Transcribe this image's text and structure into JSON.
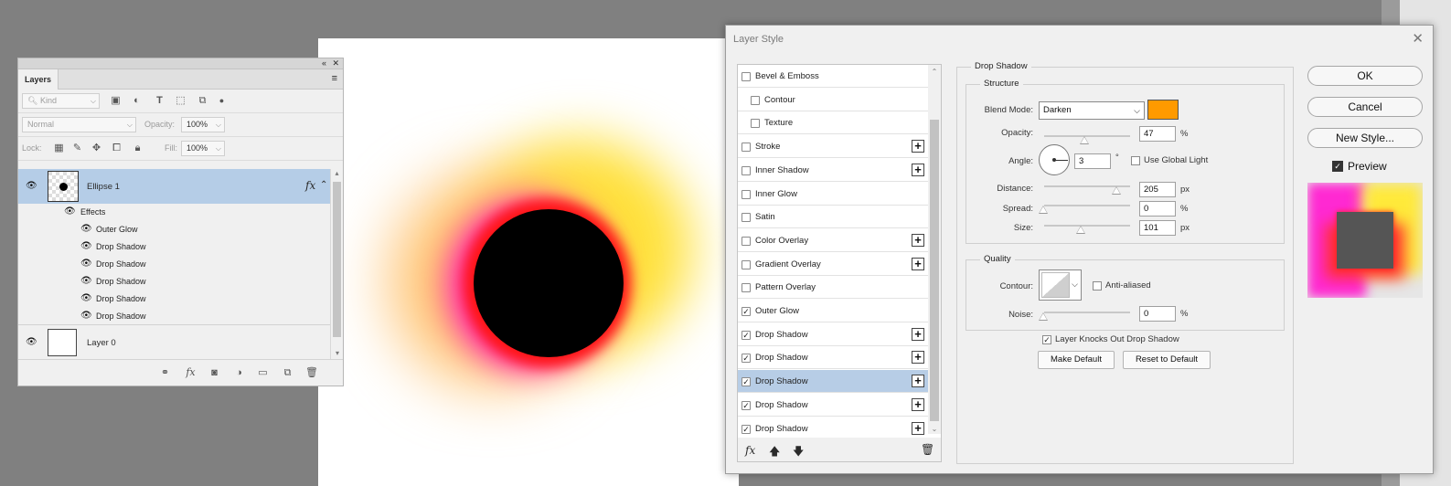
{
  "colors": {
    "shadow_color": "#ff9a00",
    "selected_row": "#b7cde6",
    "layer_selected": "#b5cde7"
  },
  "layers_panel": {
    "tab_label": "Layers",
    "filter_kind": "Kind",
    "blend_mode": "Normal",
    "opacity_label": "Opacity:",
    "opacity_value": "100%",
    "lock_label": "Lock:",
    "fill_label": "Fill:",
    "fill_value": "100%",
    "layers": [
      {
        "name": "Ellipse 1",
        "fx": "fx"
      },
      {
        "name": "Layer 0"
      }
    ],
    "effects_label": "Effects",
    "effects": [
      "Outer Glow",
      "Drop Shadow",
      "Drop Shadow",
      "Drop Shadow",
      "Drop Shadow",
      "Drop Shadow"
    ]
  },
  "dialog": {
    "title": "Layer Style",
    "styles": [
      {
        "label": "Bevel & Emboss",
        "checked": false,
        "plus": false,
        "indent": false
      },
      {
        "label": "Contour",
        "checked": false,
        "plus": false,
        "indent": true
      },
      {
        "label": "Texture",
        "checked": false,
        "plus": false,
        "indent": true
      },
      {
        "label": "Stroke",
        "checked": false,
        "plus": true,
        "indent": false
      },
      {
        "label": "Inner Shadow",
        "checked": false,
        "plus": true,
        "indent": false
      },
      {
        "label": "Inner Glow",
        "checked": false,
        "plus": false,
        "indent": false
      },
      {
        "label": "Satin",
        "checked": false,
        "plus": false,
        "indent": false
      },
      {
        "label": "Color Overlay",
        "checked": false,
        "plus": true,
        "indent": false
      },
      {
        "label": "Gradient Overlay",
        "checked": false,
        "plus": true,
        "indent": false
      },
      {
        "label": "Pattern Overlay",
        "checked": false,
        "plus": false,
        "indent": false
      },
      {
        "label": "Outer Glow",
        "checked": true,
        "plus": false,
        "indent": false
      },
      {
        "label": "Drop Shadow",
        "checked": true,
        "plus": true,
        "indent": false
      },
      {
        "label": "Drop Shadow",
        "checked": true,
        "plus": true,
        "indent": false
      },
      {
        "label": "Drop Shadow",
        "checked": true,
        "plus": true,
        "indent": false,
        "active": true
      },
      {
        "label": "Drop Shadow",
        "checked": true,
        "plus": true,
        "indent": false
      },
      {
        "label": "Drop Shadow",
        "checked": true,
        "plus": true,
        "indent": false
      }
    ],
    "section_title": "Drop Shadow",
    "structure_title": "Structure",
    "blend_mode_label": "Blend Mode:",
    "blend_mode": "Darken",
    "opacity_label": "Opacity:",
    "opacity": "47",
    "angle_label": "Angle:",
    "angle": "3",
    "global_light_label": "Use Global Light",
    "distance_label": "Distance:",
    "distance": "205",
    "spread_label": "Spread:",
    "spread": "0",
    "size_label": "Size:",
    "size": "101",
    "pct": "%",
    "px": "px",
    "deg": "°",
    "quality_title": "Quality",
    "contour_label": "Contour:",
    "antialiased_label": "Anti-aliased",
    "noise_label": "Noise:",
    "noise": "0",
    "knockout_label": "Layer Knocks Out Drop Shadow",
    "make_default": "Make Default",
    "reset_default": "Reset to Default",
    "ok": "OK",
    "cancel": "Cancel",
    "new_style": "New Style...",
    "preview_label": "Preview",
    "fx_label": "fx"
  }
}
